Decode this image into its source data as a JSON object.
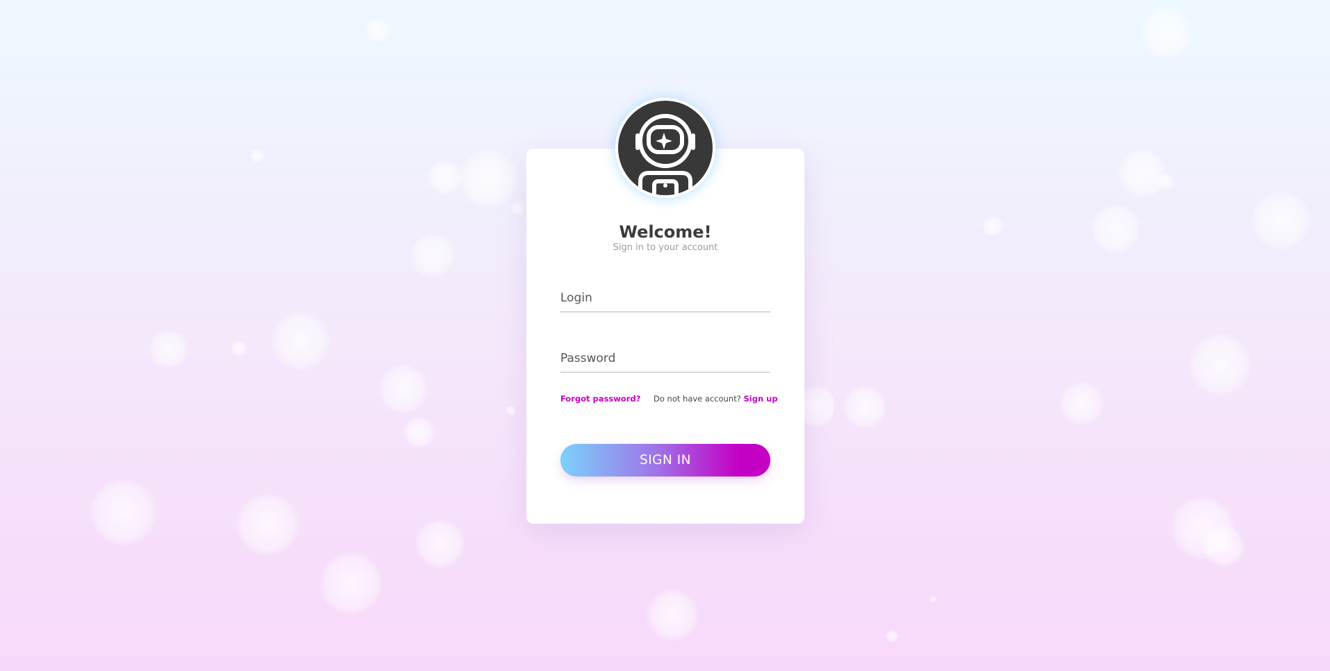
{
  "app": {
    "heading": "Welcome!",
    "subtitle": "Sign in to your account",
    "avatar_icon": "astronaut-icon"
  },
  "form": {
    "login_placeholder": "Login",
    "password_placeholder": "Password",
    "forgot_password": "Forgot password?",
    "no_account_text": "Do not have account?",
    "sign_up": "Sign up",
    "submit_label": "SIGN IN"
  },
  "colors": {
    "accent": "#c400c4",
    "gradient_start": "#7bd1fb",
    "gradient_end": "#c400c4",
    "avatar_dark": "#383838"
  }
}
